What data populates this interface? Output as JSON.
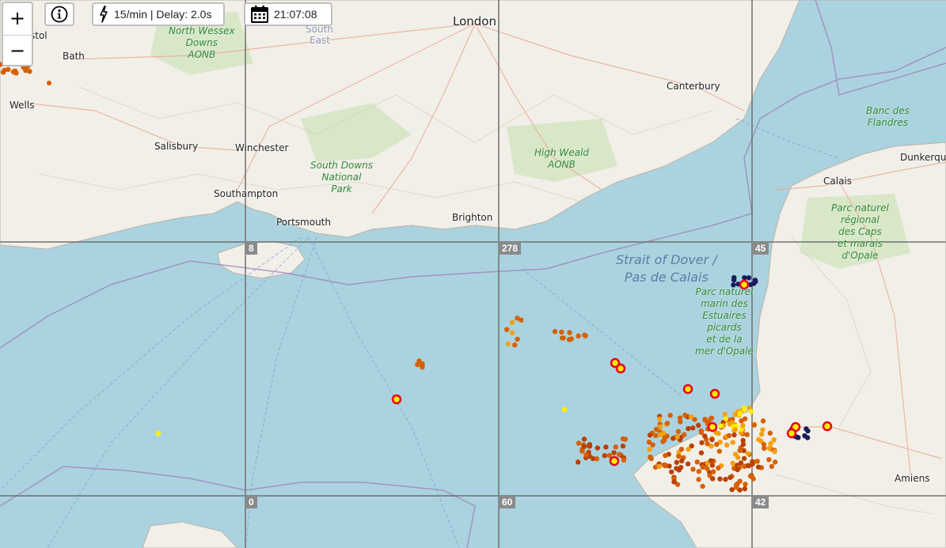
{
  "controls": {
    "zoom_in": "+",
    "zoom_out": "−",
    "info_icon": "info-icon",
    "rate_text": "15/min | Delay: 2.0s",
    "time_text": "21:07:08"
  },
  "places": {
    "bristol": "stol",
    "bath": "Bath",
    "wells": "Wells",
    "salisbury": "Salisbury",
    "winchester": "Winchester",
    "southampton": "Southampton",
    "portsmouth": "Portsmouth",
    "brighton": "Brighton",
    "london": "London",
    "canterbury": "Canterbury",
    "calais": "Calais",
    "dunkerque": "Dunkerque",
    "amiens": "Amiens",
    "east": "East",
    "south": "South"
  },
  "parks": {
    "north_wessex": [
      "North Wessex",
      "Downs",
      "AONB"
    ],
    "south_downs": [
      "South Downs",
      "National",
      "Park"
    ],
    "high_weald": [
      "High Weald",
      "AONB"
    ],
    "banc_flandres": [
      "Banc des",
      "Flandres"
    ],
    "caps_marais": [
      "Parc naturel",
      "régional",
      "des Caps",
      "et marais",
      "d'Opale"
    ],
    "estuaires": [
      "Parc naturel",
      "marin des",
      "Estuaires",
      "picards",
      "et de la",
      "mer d'Opale"
    ]
  },
  "sea": [
    "Strait of Dover /",
    "Pas de Calais"
  ],
  "grid_numbers": {
    "g8": "8",
    "g278": "278",
    "g45": "45",
    "g0": "0",
    "g60": "60",
    "g42": "42"
  },
  "colors": {
    "sea": "#aad3df",
    "land": "#f2efe9",
    "strike_recent": "#ffee00",
    "strike_mid": "#f5a00a",
    "strike_old": "#d66000",
    "strike_oldest": "#b84000",
    "strike_dark": "#1a1a5e",
    "marker_ring": "#e8001c"
  }
}
